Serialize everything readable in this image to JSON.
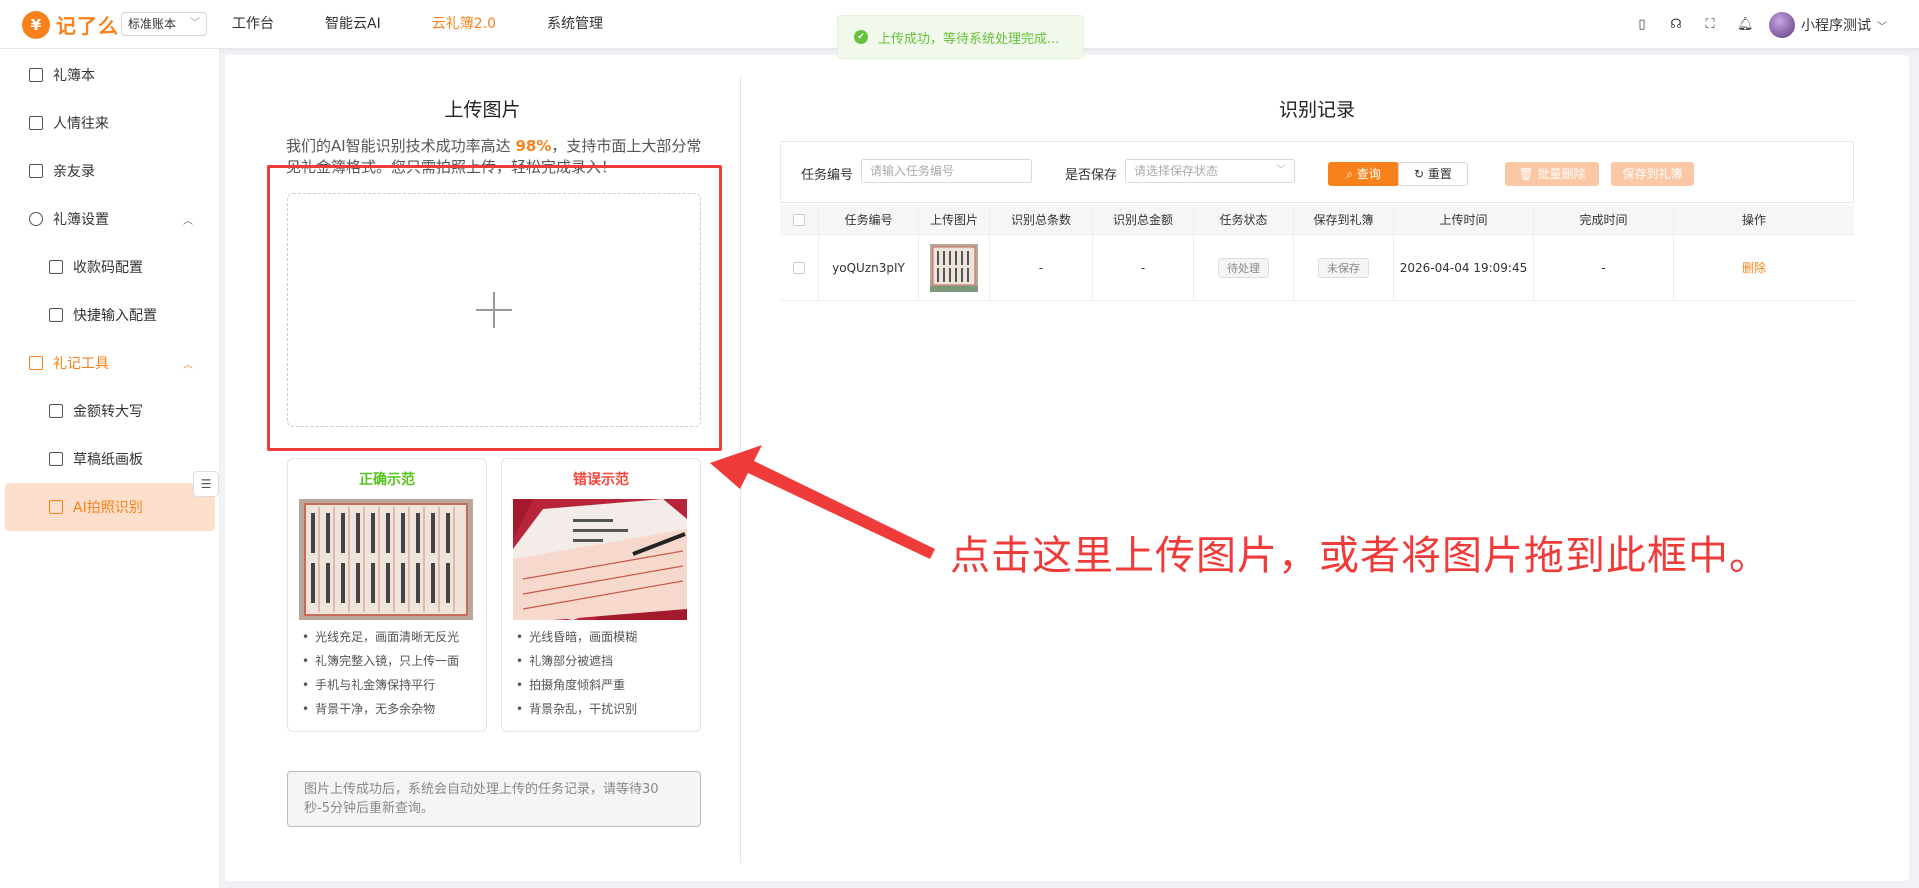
{
  "header": {
    "logo_text": "记了么",
    "logo_mark": "¥",
    "book_select": "标准账本",
    "nav": [
      {
        "label": "工作台",
        "active": false
      },
      {
        "label": "智能云AI",
        "active": false
      },
      {
        "label": "云礼簿2.0",
        "active": true
      },
      {
        "label": "系统管理",
        "active": false
      }
    ],
    "user_name": "小程序测试"
  },
  "toast": {
    "text": "上传成功，等待系统处理完成..."
  },
  "sidebar": {
    "items": [
      {
        "label": "礼簿本"
      },
      {
        "label": "人情往来"
      },
      {
        "label": "亲友录"
      },
      {
        "label": "礼簿设置"
      },
      {
        "label": "收款码配置"
      },
      {
        "label": "快捷输入配置"
      },
      {
        "label": "礼记工具"
      },
      {
        "label": "金额转大写"
      },
      {
        "label": "草稿纸画板"
      },
      {
        "label": "AI拍照识别"
      }
    ]
  },
  "upload": {
    "title": "上传图片",
    "desc_prefix": "我们的AI智能识别技术成功率高达 ",
    "desc_highlight": "98%",
    "desc_suffix": "，支持市面上大部分常见礼金簿格式。您只需拍照上传，轻松完成录入！",
    "good_sample": {
      "title": "正确示范",
      "tips": [
        "光线充足，画面清晰无反光",
        "礼簿完整入镜，只上传一面",
        "手机与礼金簿保持平行",
        "背景干净，无多余杂物"
      ]
    },
    "bad_sample": {
      "title": "错误示范",
      "tips": [
        "光线昏暗，画面模糊",
        "礼簿部分被遮挡",
        "拍摄角度倾斜严重",
        "背景杂乱，干扰识别"
      ]
    },
    "notice": "图片上传成功后，系统会自动处理上传的任务记录，请等待30秒-5分钟后重新查询。"
  },
  "records": {
    "title": "识别记录",
    "filter": {
      "task_label": "任务编号",
      "task_placeholder": "请输入任务编号",
      "save_label": "是否保存",
      "save_placeholder": "请选择保存状态",
      "query": "查询",
      "reset": "重置",
      "batch_delete": "批量删除",
      "save_to_book": "保存到礼簿"
    },
    "columns": [
      "任务编号",
      "上传图片",
      "识别总条数",
      "识别总金额",
      "任务状态",
      "保存到礼簿",
      "上传时间",
      "完成时间",
      "操作"
    ],
    "rows": [
      {
        "task_id": "yoQUzn3pIY",
        "count": "-",
        "amount": "-",
        "status": "待处理",
        "saved": "未保存",
        "upload_time": "2026-04-04 19:09:45",
        "finish_time": "-",
        "action": "删除"
      }
    ]
  },
  "annotation": {
    "text": "点击这里上传图片，或者将图片拖到此框中。"
  }
}
